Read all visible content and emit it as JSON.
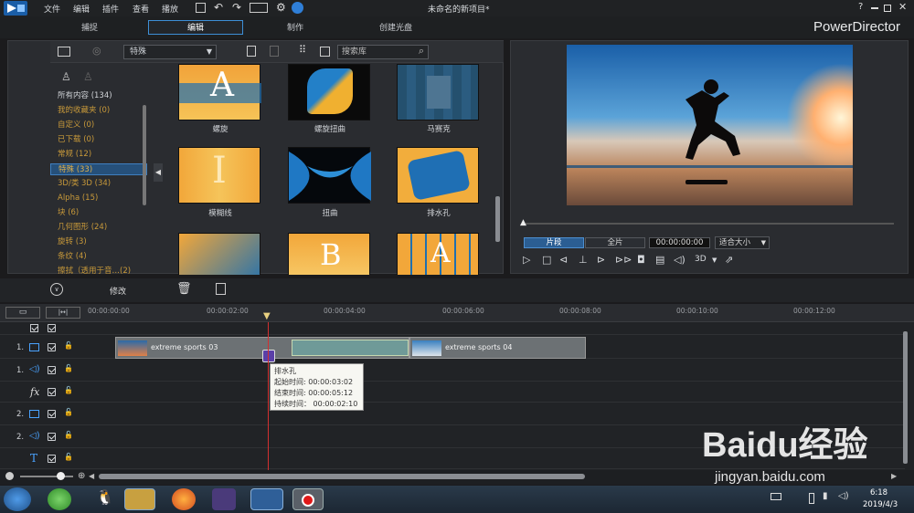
{
  "menu": {
    "file": "文件",
    "edit": "编辑",
    "plugins": "插件",
    "view": "查看",
    "playback": "播放"
  },
  "project_title": "未命名的新项目*",
  "help": "?",
  "brand": "PowerDirector",
  "tabs": {
    "capture": "捕捉",
    "edit": "编辑",
    "produce": "制作",
    "create_disc": "创建光盘"
  },
  "library": {
    "dropdown": "特殊",
    "search_placeholder": "搜索库",
    "categories": [
      "所有内容 (134)",
      "我的收藏夹 (0)",
      "自定义 (0)",
      "已下载 (0)",
      "常规 (12)",
      "特殊 (33)",
      "3D/类 3D (34)",
      "Alpha (15)",
      "块 (6)",
      "几何图形 (24)",
      "旋转 (3)",
      "条纹 (4)",
      "擦拭（透用于音…(2)"
    ],
    "thumbs": [
      "螺旋",
      "螺旋扭曲",
      "马赛克",
      "模糊线",
      "扭曲",
      "排水孔"
    ]
  },
  "preview": {
    "clip": "片段",
    "full": "全片",
    "timecode": "00:00:00:00",
    "fit": "适合大小",
    "mode3d": "3D"
  },
  "timeline": {
    "modify": "修改",
    "ruler": [
      "00:00:00:00",
      "00:00:02:00",
      "00:00:04:00",
      "00:00:06:00",
      "00:00:08:00",
      "00:00:10:00",
      "00:00:12:00"
    ],
    "tracks": [
      "1.",
      "1.",
      "2.",
      "2."
    ],
    "clip1": "extreme sports 03",
    "clip2": "extreme sports 04",
    "tooltip": {
      "name": "排水孔",
      "start": "起始时间: 00:00:03:02",
      "end": "结束时间: 00:00:05:12",
      "duration": "持续时间： 00:00:02:10"
    }
  },
  "taskbar": {
    "time": "6:18",
    "date": "2019/4/3"
  },
  "watermark": {
    "brand": "Baidu经验",
    "url": "jingyan.baidu.com"
  }
}
